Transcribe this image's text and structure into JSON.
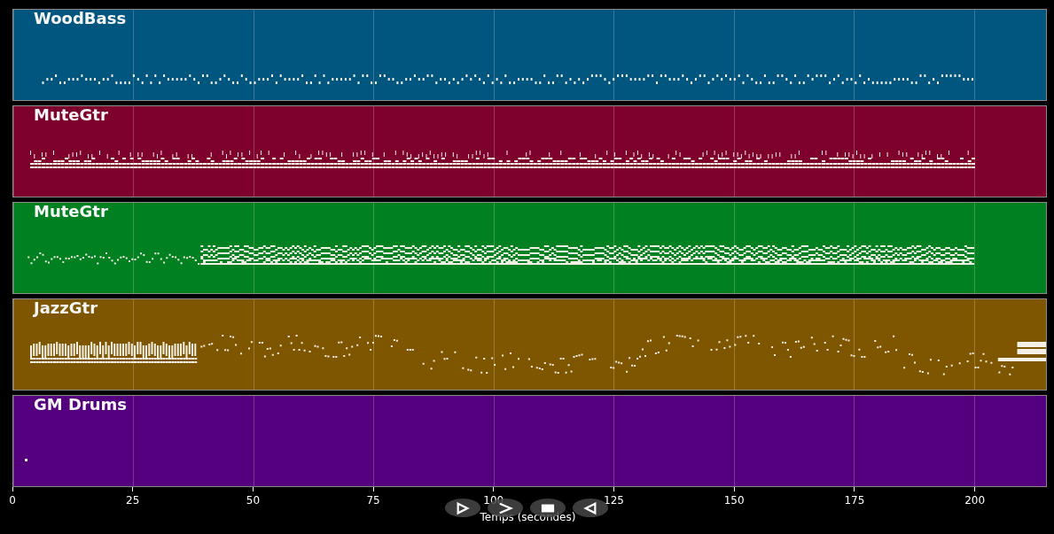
{
  "tracks": [
    {
      "name": "WoodBass",
      "color": "#00567e"
    },
    {
      "name": "MuteGtr",
      "color": "#7e002d"
    },
    {
      "name": "MuteGtr",
      "color": "#008020"
    },
    {
      "name": "JazzGtr",
      "color": "#7e5600"
    },
    {
      "name": "GM Drums",
      "color": "#54007e"
    }
  ],
  "axis": {
    "ticks": [
      "0",
      "25",
      "50",
      "75",
      "100",
      "125",
      "150",
      "175",
      "200"
    ],
    "label": "Temps (secondes)"
  },
  "controls": [
    {
      "kind": "play"
    },
    {
      "kind": "forward"
    },
    {
      "kind": "stop"
    },
    {
      "kind": "back"
    }
  ]
}
